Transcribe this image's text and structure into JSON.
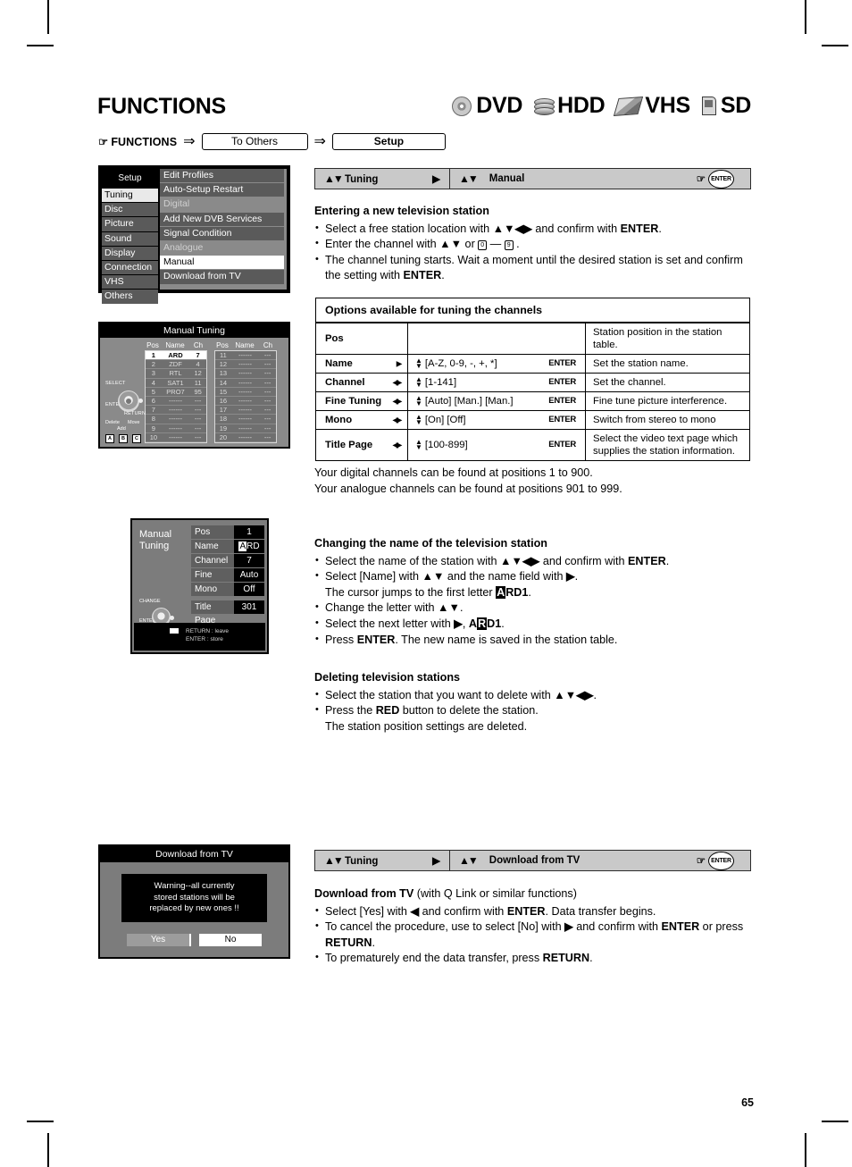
{
  "page": {
    "title": "FUNCTIONS",
    "number": "65"
  },
  "media_icons": [
    {
      "icon": "dvd-disc-icon",
      "label": "DVD"
    },
    {
      "icon": "hdd-icon",
      "label": "HDD"
    },
    {
      "icon": "vhs-cassette-icon",
      "label": "VHS"
    },
    {
      "icon": "sd-card-icon",
      "label": "SD"
    }
  ],
  "breadcrumb": {
    "lead": "FUNCTIONS",
    "step1": "To Others",
    "step2": "Setup"
  },
  "setup_menu": {
    "header": "Setup",
    "left_items": [
      {
        "label": "Tuning",
        "selected": true
      },
      {
        "label": "Disc",
        "selected": false
      },
      {
        "label": "Picture",
        "selected": false
      },
      {
        "label": "Sound",
        "selected": false
      },
      {
        "label": "Display",
        "selected": false
      },
      {
        "label": "Connection",
        "selected": false
      },
      {
        "label": "VHS",
        "selected": false
      },
      {
        "label": "Others",
        "selected": false
      }
    ],
    "right_items": [
      {
        "label": "Edit Profiles",
        "state": "normal"
      },
      {
        "label": "Auto-Setup Restart",
        "state": "normal"
      },
      {
        "label": "Digital",
        "state": "dim"
      },
      {
        "label": "Add New DVB Services",
        "state": "normal"
      },
      {
        "label": "Signal Condition",
        "state": "normal"
      },
      {
        "label": "Analogue",
        "state": "dim"
      },
      {
        "label": "Manual",
        "state": "selected"
      },
      {
        "label": "Download from TV",
        "state": "normal"
      }
    ]
  },
  "manual_tuning_osd": {
    "title": "Manual Tuning",
    "headers": [
      "Pos",
      "Name",
      "Ch"
    ],
    "left_rows": [
      {
        "pos": "1",
        "name": "ARD",
        "ch": "7",
        "selected": true
      },
      {
        "pos": "2",
        "name": "ZDF",
        "ch": "4",
        "selected": false
      },
      {
        "pos": "3",
        "name": "RTL",
        "ch": "12",
        "selected": false
      },
      {
        "pos": "4",
        "name": "SAT1",
        "ch": "11",
        "selected": false
      },
      {
        "pos": "5",
        "name": "PRO7",
        "ch": "95",
        "selected": false
      },
      {
        "pos": "6",
        "name": "------",
        "ch": "---",
        "selected": false
      },
      {
        "pos": "7",
        "name": "------",
        "ch": "---",
        "selected": false
      },
      {
        "pos": "8",
        "name": "------",
        "ch": "---",
        "selected": false
      },
      {
        "pos": "9",
        "name": "------",
        "ch": "---",
        "selected": false
      },
      {
        "pos": "10",
        "name": "------",
        "ch": "---",
        "selected": false
      }
    ],
    "right_rows": [
      {
        "pos": "11",
        "name": "------",
        "ch": "---"
      },
      {
        "pos": "12",
        "name": "------",
        "ch": "---"
      },
      {
        "pos": "13",
        "name": "------",
        "ch": "---"
      },
      {
        "pos": "14",
        "name": "------",
        "ch": "---"
      },
      {
        "pos": "15",
        "name": "------",
        "ch": "---"
      },
      {
        "pos": "16",
        "name": "------",
        "ch": "---"
      },
      {
        "pos": "17",
        "name": "------",
        "ch": "---"
      },
      {
        "pos": "18",
        "name": "------",
        "ch": "---"
      },
      {
        "pos": "19",
        "name": "------",
        "ch": "---"
      },
      {
        "pos": "20",
        "name": "------",
        "ch": "---"
      }
    ],
    "pad_labels": {
      "select": "SELECT",
      "enter": "ENTER",
      "return": "RETURN",
      "delete": "Delete",
      "add": "Add",
      "move": "Move",
      "key_a": "A",
      "key_b": "B",
      "key_c": "C"
    }
  },
  "manual_tuning_detail": {
    "label_line1": "Manual",
    "label_line2": "Tuning",
    "rows": [
      {
        "key": "Pos",
        "value": "1",
        "cursor": ""
      },
      {
        "key": "Name",
        "value": "ARD",
        "cursor": "A"
      },
      {
        "key": "Channel",
        "value": "7",
        "cursor": ""
      },
      {
        "key": "Fine Tuning",
        "value": "Auto",
        "cursor": ""
      },
      {
        "key": "Mono",
        "value": "Off",
        "cursor": ""
      },
      {
        "key": "Title Page",
        "value": "301",
        "cursor": ""
      }
    ],
    "pad_labels": {
      "change": "CHANGE",
      "enter": "ENTER",
      "return": "RETURN"
    },
    "footer": [
      "RETURN : leave",
      "ENTER : store"
    ]
  },
  "download_osd": {
    "title": "Download from TV",
    "warning": [
      "Warning--all currently",
      "stored stations will be",
      "replaced by new ones !!"
    ],
    "buttons": [
      {
        "label": "Yes",
        "selected": true
      },
      {
        "label": "No",
        "selected": false
      }
    ]
  },
  "nav_manual": {
    "seg1": "Tuning",
    "seg2": "Manual",
    "enter": "ENTER"
  },
  "nav_download": {
    "seg1": "Tuning",
    "seg2": "Download from TV",
    "enter": "ENTER"
  },
  "section_entering": {
    "heading": "Entering a new television station",
    "bullets": [
      "Select a free station location with ▲▼◀▶ and confirm with ENTER.",
      "Enter the channel with ▲▼ or 0 — 9 .",
      "The channel tuning starts. Wait a moment until the desired station is set and confirm the setting with ENTER."
    ]
  },
  "options_table": {
    "heading": "Options available for tuning the channels",
    "rows": [
      {
        "name": "Pos",
        "nav": "",
        "range": "",
        "enter": "",
        "desc": "Station position in the station table."
      },
      {
        "name": "Name",
        "nav": "▶",
        "range": "[A-Z, 0-9, -, +, *]",
        "enter": "ENTER",
        "desc": "Set the station name."
      },
      {
        "name": "Channel",
        "nav": "◀▶",
        "range": "[1-141]",
        "enter": "ENTER",
        "desc": "Set the channel."
      },
      {
        "name": "Fine Tuning",
        "nav": "◀▶",
        "range": "[Auto] [Man.]  [Man.]",
        "enter": "ENTER",
        "desc": "Fine tune picture interference."
      },
      {
        "name": "Mono",
        "nav": "◀▶",
        "range": "[On] [Off]",
        "enter": "ENTER",
        "desc": "Switch from stereo to mono"
      },
      {
        "name": "Title Page",
        "nav": "◀▶",
        "range": "[100-899]",
        "enter": "ENTER",
        "desc": "Select the video text page which supplies the station information."
      }
    ]
  },
  "note_positions": [
    "Your digital channels can be found at positions 1 to 900.",
    "Your analogue channels can be found at positions 901 to 999."
  ],
  "section_changing": {
    "heading": "Changing the name of the television station",
    "bullets": [
      "Select the name of the station with ▲▼◀▶ and confirm with ENTER.",
      "Select [Name] with ▲▼ and the name field with ▶.",
      "The cursor jumps to the first letter ARD1.",
      "Change the letter with ▲▼.",
      "Select the next letter with ▶, ARD1.",
      "Press ENTER. The new name is saved in the station table."
    ]
  },
  "section_deleting": {
    "heading": "Deleting television stations",
    "bullets": [
      "Select the station that you want to delete with ▲▼◀▶.",
      "Press the RED button to delete the station.",
      "The station position settings are deleted."
    ]
  },
  "section_download": {
    "heading": "Download from TV",
    "heading_suffix": "(with Q Link or similar functions)",
    "bullets": [
      "Select [Yes] with ◀ and confirm with ENTER. Data transfer begins.",
      "To cancel the procedure, use to select [No] with ▶ and confirm with ENTER or press RETURN.",
      "To prematurely end the data transfer, press RETURN."
    ]
  }
}
